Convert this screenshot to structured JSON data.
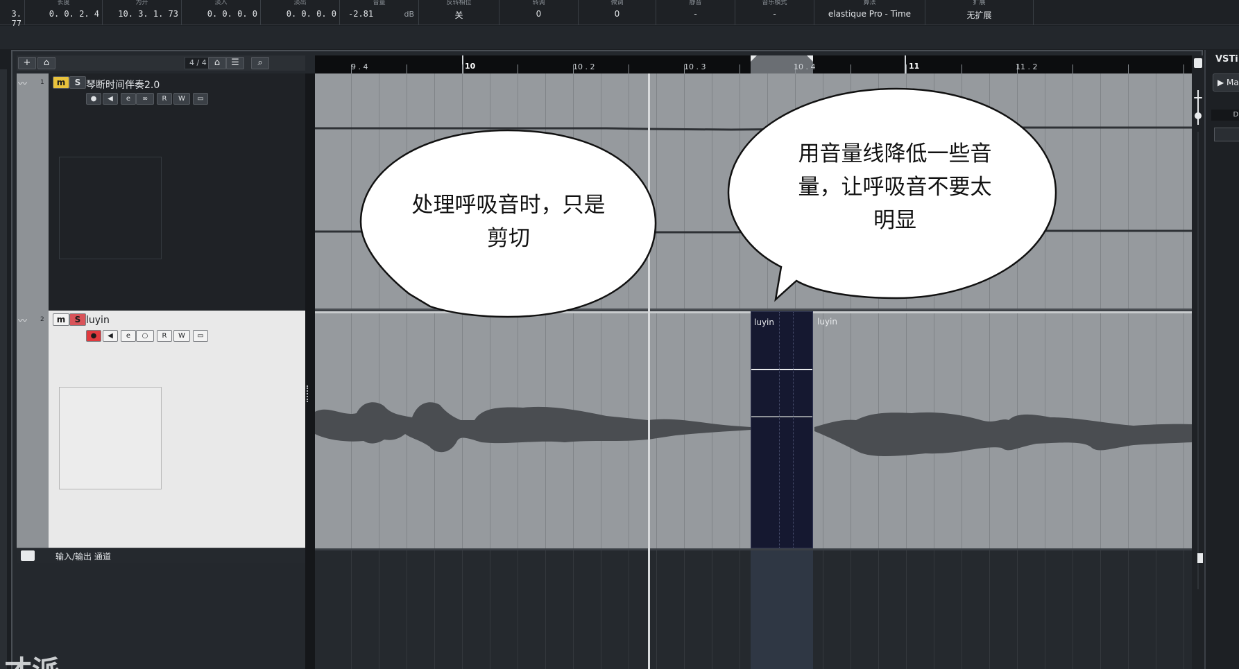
{
  "infobar": {
    "cells": [
      {
        "label": "",
        "value": "3. 77"
      },
      {
        "label": "长度",
        "value": "0. 0. 2.  4"
      },
      {
        "label": "为开",
        "value": "10. 3. 1. 73"
      },
      {
        "label": "淡入",
        "value": "0. 0. 0.  0"
      },
      {
        "label": "淡出",
        "value": "0. 0. 0.  0"
      },
      {
        "label": "音量",
        "value": "-2.81",
        "unit": "dB"
      },
      {
        "label": "反转相位",
        "value": "关"
      },
      {
        "label": "转调",
        "value": "0"
      },
      {
        "label": "微调",
        "value": "0"
      },
      {
        "label": "静音",
        "value": "-"
      },
      {
        "label": "音乐模式",
        "value": "-"
      },
      {
        "label": "算法",
        "value": "elastique Pro - Time"
      },
      {
        "label": "扩展",
        "value": "无扩展"
      }
    ]
  },
  "toolbar": {
    "add_track": "+",
    "add_folder": "⌂",
    "time_signature": "4 / 4",
    "home_icon": "⌂",
    "list_icon": "☰",
    "search_icon": "⌕"
  },
  "tracks": [
    {
      "number": "1",
      "name": "琴断时间伴奏2.0",
      "mute": "m",
      "solo": "S",
      "buttons": [
        "●",
        "◀",
        "e",
        "∞",
        "R",
        "W",
        "▭"
      ]
    },
    {
      "number": "2",
      "name": "luyin",
      "mute": "m",
      "solo": "S",
      "buttons": [
        "●",
        "◀",
        "e",
        "○",
        "R",
        "W",
        "▭"
      ]
    }
  ],
  "folder_track": {
    "name": "输入/输出 通道"
  },
  "ruler": {
    "labels": [
      {
        "text": "9 . 4",
        "major": false
      },
      {
        "text": "10",
        "major": true
      },
      {
        "text": "10 . 2",
        "major": false
      },
      {
        "text": "10 . 3",
        "major": false
      },
      {
        "text": "10 . 4",
        "major": false
      },
      {
        "text": "11",
        "major": true
      },
      {
        "text": "11 . 2",
        "major": false
      }
    ]
  },
  "events": {
    "selected": "luyin",
    "next": "luyin"
  },
  "bubbles": {
    "left": "处理呼吸音时，只是\n剪切",
    "right": "用音量线降低一些音\n量，让呼吸音不要太\n明显"
  },
  "side_panel": {
    "title": "VSTi",
    "instrument_button": "▶ Ma",
    "bar_text": "Di"
  },
  "watermark": "才派",
  "colors": {
    "mute_on": "#e8c23c",
    "solo_on": "#d9545a",
    "record_on": "#e03a3e",
    "waveform": "#4a4d51",
    "selected_event": "#151830"
  }
}
